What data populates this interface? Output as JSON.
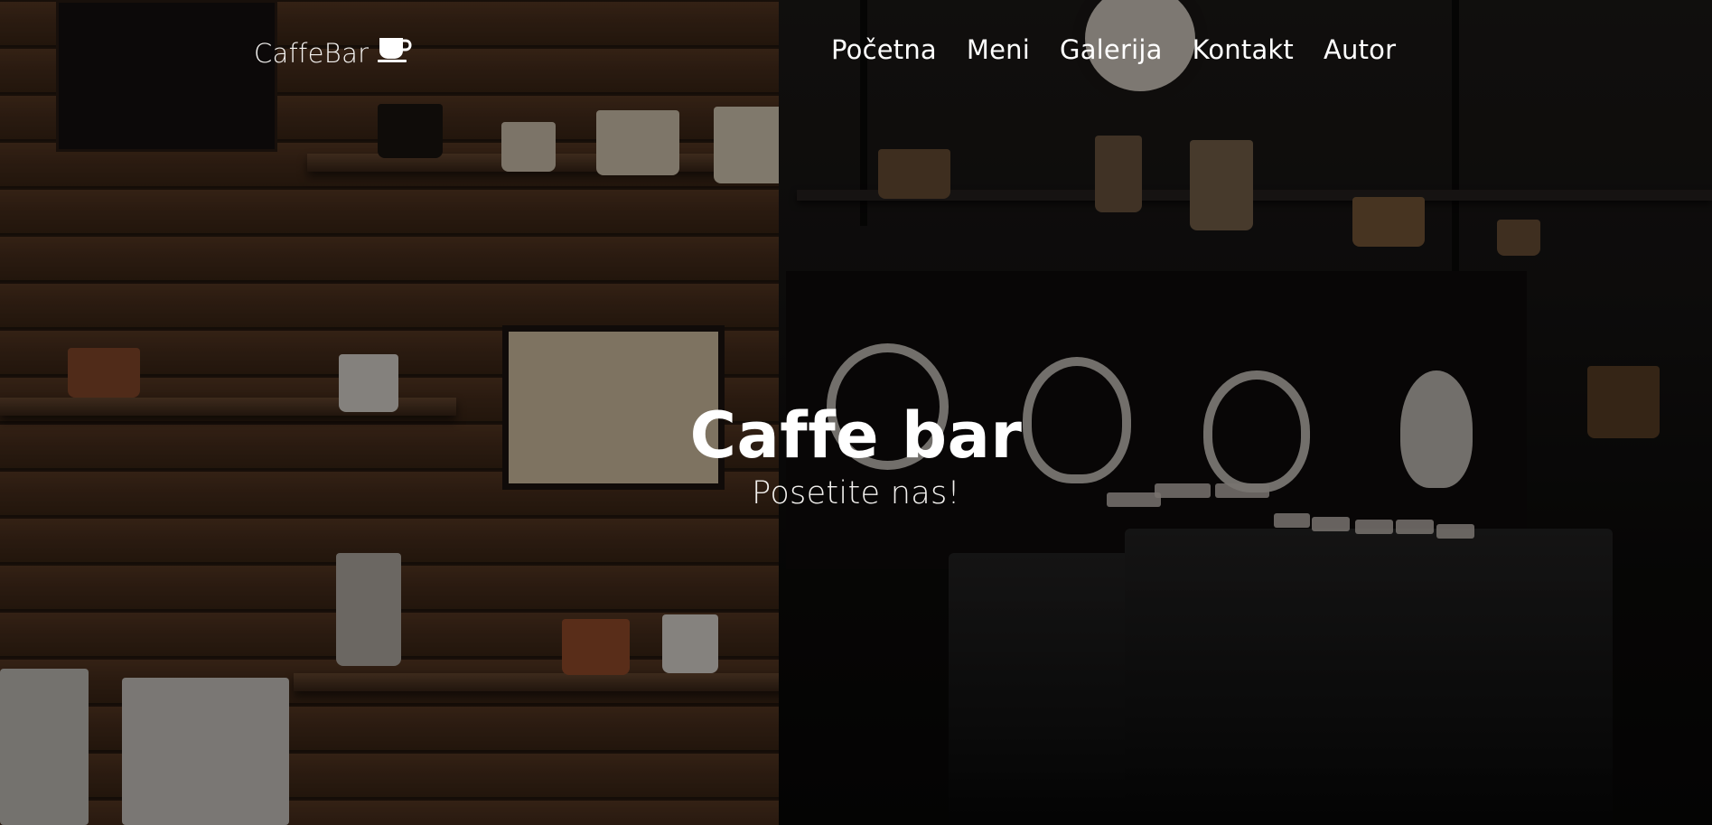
{
  "navbar": {
    "brand": "CaffeBar",
    "brand_icon": "coffee-cup-icon",
    "links": [
      "Početna",
      "Meni",
      "Galerija",
      "Kontakt",
      "Autor"
    ]
  },
  "hero": {
    "title": "Caffe bar",
    "subtitle": "Posetite nas!",
    "background": "photo of cafe interior with wooden wall shelves and espresso machine"
  },
  "colors": {
    "text": "#ffffff",
    "overlay": "rgba(0,0,0,0.42)"
  }
}
